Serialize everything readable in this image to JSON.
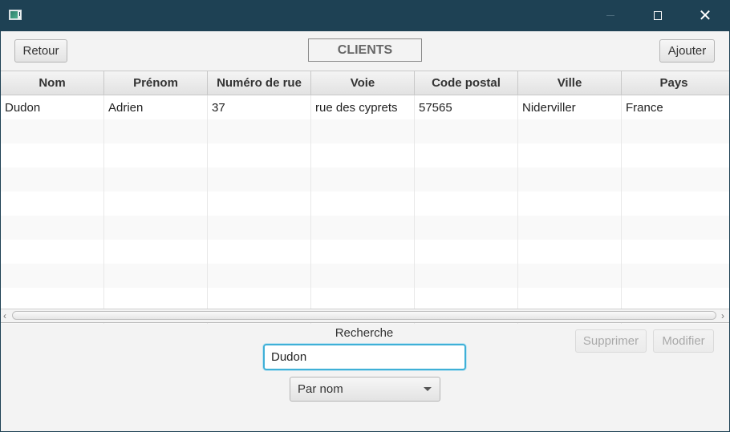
{
  "window": {
    "icon": "java-app-icon",
    "controls": {
      "minimize": "minimize-icon",
      "maximize": "maximize-icon",
      "close": "✕"
    }
  },
  "header": {
    "back_label": "Retour",
    "title": "CLIENTS",
    "add_label": "Ajouter"
  },
  "table": {
    "columns": [
      "Nom",
      "Prénom",
      "Numéro de rue",
      "Voie",
      "Code postal",
      "Ville",
      "Pays"
    ],
    "rows": [
      [
        "Dudon",
        "Adrien",
        "37",
        "rue des cyprets",
        "57565",
        "Niderviller",
        "France"
      ]
    ]
  },
  "search": {
    "label": "Recherche",
    "value": "Dudon",
    "mode": "Par nom"
  },
  "actions": {
    "delete_label": "Supprimer",
    "edit_label": "Modifier"
  }
}
